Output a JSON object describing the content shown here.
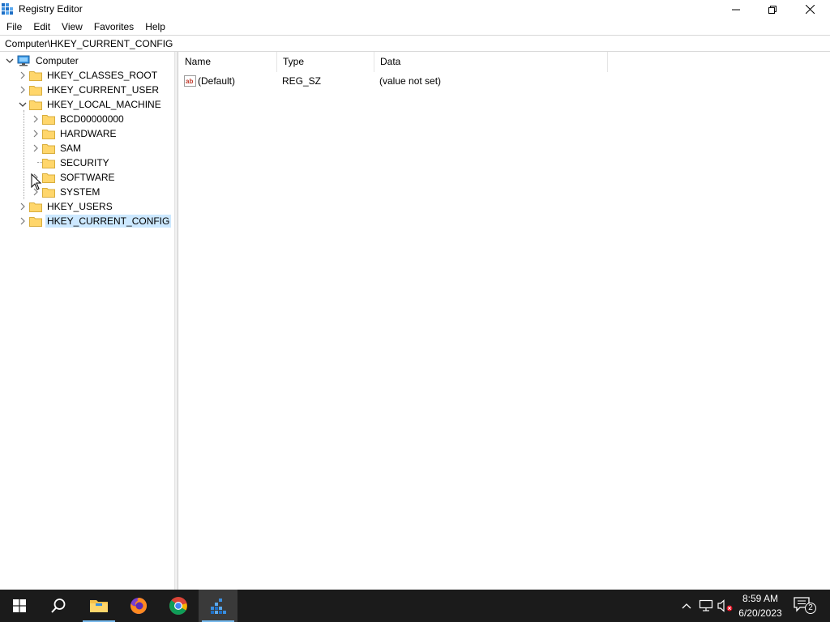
{
  "window": {
    "title": "Registry Editor",
    "icon": "registry-editor-icon"
  },
  "menu": [
    "File",
    "Edit",
    "View",
    "Favorites",
    "Help"
  ],
  "address": "Computer\\HKEY_CURRENT_CONFIG",
  "tree": {
    "root": "Computer",
    "hives": [
      {
        "label": "HKEY_CLASSES_ROOT"
      },
      {
        "label": "HKEY_CURRENT_USER"
      },
      {
        "label": "HKEY_LOCAL_MACHINE",
        "expanded": true
      },
      {
        "label": "HKEY_USERS"
      },
      {
        "label": "HKEY_CURRENT_CONFIG",
        "selected": true
      }
    ],
    "hklm_children": [
      {
        "label": "BCD00000000"
      },
      {
        "label": "HARDWARE"
      },
      {
        "label": "SAM"
      },
      {
        "label": "SECURITY"
      },
      {
        "label": "SOFTWARE"
      },
      {
        "label": "SYSTEM"
      }
    ]
  },
  "list": {
    "columns": [
      "Name",
      "Type",
      "Data"
    ],
    "rows": [
      {
        "name": "(Default)",
        "type": "REG_SZ",
        "data": "(value not set)",
        "icon": "string-value-icon"
      }
    ]
  },
  "taskbar": {
    "apps": [
      "start-icon",
      "search-icon",
      "file-explorer-icon",
      "firefox-icon",
      "chrome-icon",
      "registry-editor-icon"
    ],
    "clock_time": "8:59 AM",
    "clock_date": "6/20/2023",
    "notification_count": "2"
  },
  "colors": {
    "selection": "#cce8ff",
    "folder": "#ffd66b",
    "taskbar": "#1b1b1b",
    "accent": "#76b9ed"
  }
}
